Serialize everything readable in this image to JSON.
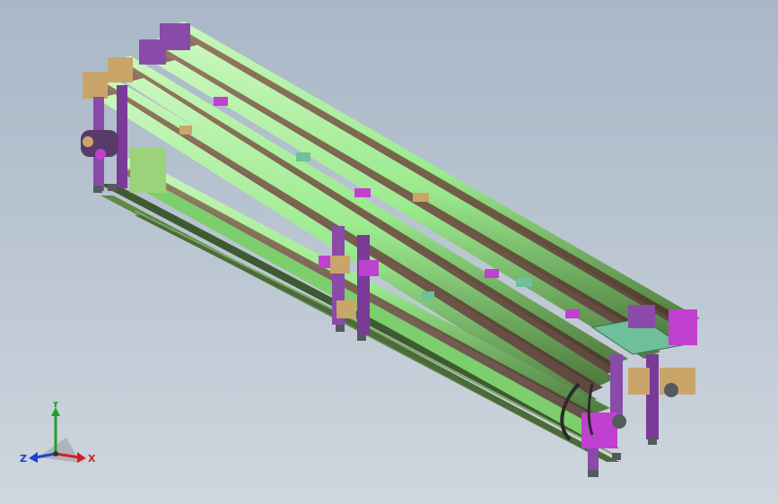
{
  "view": {
    "background_top": "#a9b7c7",
    "background_bottom": "#cfd6de"
  },
  "model": {
    "type": "conveyor-assembly",
    "colors": {
      "rail_green": "#9bea8e",
      "rail_dark": "#3e5a30",
      "belt_brown": "#6b4a3a",
      "frame_purple": "#8a4aa8",
      "bracket_magenta": "#c040d0",
      "bracket_tan": "#c9a56a",
      "plate_teal": "#6fc09a",
      "foot_gray": "#555a5e"
    }
  },
  "triad": {
    "x_label": "X",
    "y_label": "Y",
    "z_label": "Z",
    "x_color": "#d42020",
    "y_color": "#20a030",
    "z_color": "#2040d0"
  }
}
